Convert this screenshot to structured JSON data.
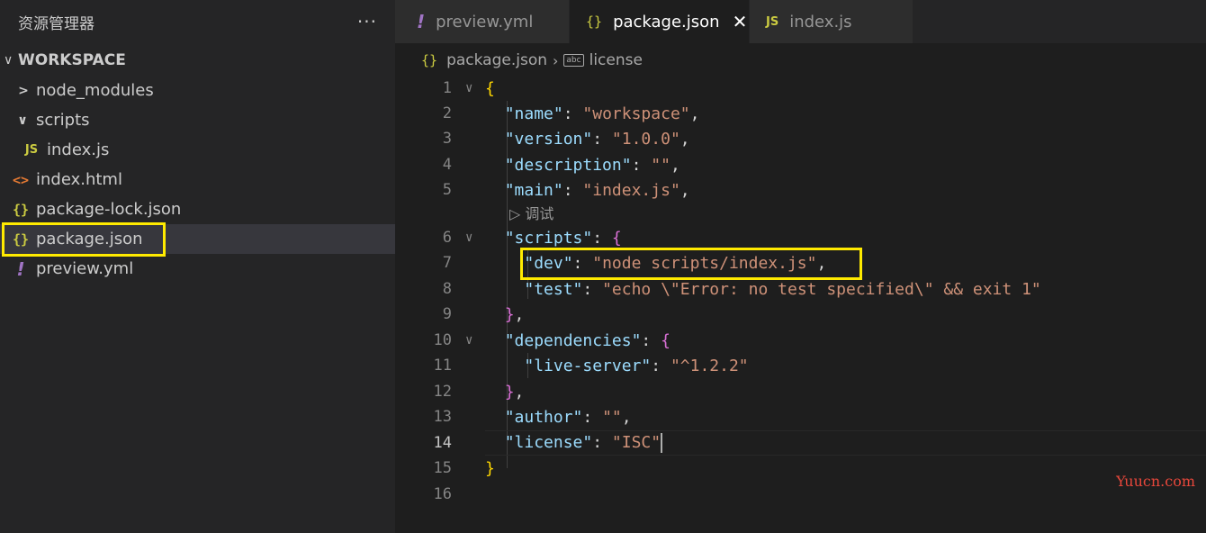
{
  "sidebar": {
    "title": "资源管理器",
    "more": "···",
    "workspace": "WORKSPACE",
    "items": [
      {
        "label": "node_modules",
        "icon": "chevron-right-icon",
        "glyph": ">"
      },
      {
        "label": "scripts",
        "icon": "chevron-down-icon",
        "glyph": "∨"
      },
      {
        "label": "index.js",
        "icon": "js-icon",
        "glyph": "JS"
      },
      {
        "label": "index.html",
        "icon": "html-icon",
        "glyph": "<>"
      },
      {
        "label": "package-lock.json",
        "icon": "json-icon",
        "glyph": "{}"
      },
      {
        "label": "package.json",
        "icon": "json-icon",
        "glyph": "{}"
      },
      {
        "label": "preview.yml",
        "icon": "yml-icon",
        "glyph": "!"
      }
    ]
  },
  "tabs": [
    {
      "label": "preview.yml",
      "icon": "yml-icon",
      "glyph": "!"
    },
    {
      "label": "package.json",
      "icon": "json-icon",
      "glyph": "{}",
      "close": "✕"
    },
    {
      "label": "index.js",
      "icon": "js-icon",
      "glyph": "JS"
    }
  ],
  "breadcrumb": {
    "icon_glyph": "{}",
    "file": "package.json",
    "sep": "›",
    "abc": "abc",
    "symbol": "license"
  },
  "editor": {
    "line_numbers": [
      "1",
      "2",
      "3",
      "4",
      "5",
      "6",
      "7",
      "8",
      "9",
      "10",
      "11",
      "12",
      "13",
      "14",
      "15",
      "16"
    ],
    "codelens": "▷ 调试",
    "lines": {
      "l2": {
        "k": "\"name\"",
        "p": ": ",
        "v": "\"workspace\"",
        "e": ","
      },
      "l3": {
        "k": "\"version\"",
        "p": ": ",
        "v": "\"1.0.0\"",
        "e": ","
      },
      "l4": {
        "k": "\"description\"",
        "p": ": ",
        "v": "\"\"",
        "e": ","
      },
      "l5": {
        "k": "\"main\"",
        "p": ": ",
        "v": "\"index.js\"",
        "e": ","
      },
      "l6": {
        "k": "\"scripts\"",
        "p": ": ",
        "b": "{"
      },
      "l7": {
        "k": "\"dev\"",
        "p": ": ",
        "v": "\"node scripts/index.js\"",
        "e": ","
      },
      "l8": {
        "k": "\"test\"",
        "p": ": ",
        "v": "\"echo \\\"Error: no test specified\\\" && exit 1\""
      },
      "l9": {
        "b": "}",
        "e": ","
      },
      "l10": {
        "k": "\"dependencies\"",
        "p": ": ",
        "b": "{"
      },
      "l11": {
        "k": "\"live-server\"",
        "p": ": ",
        "v": "\"^1.2.2\""
      },
      "l12": {
        "b": "}",
        "e": ","
      },
      "l13": {
        "k": "\"author\"",
        "p": ": ",
        "v": "\"\"",
        "e": ","
      },
      "l14": {
        "k": "\"license\"",
        "p": ": ",
        "v": "\"ISC\""
      },
      "l1": {
        "b": "{"
      },
      "l15": {
        "b": "}"
      }
    },
    "current_line": "14"
  },
  "watermark": "Yuucn.com",
  "colors": {
    "highlight": "#ffea00",
    "key": "#9cdcfe",
    "string": "#ce9178"
  }
}
